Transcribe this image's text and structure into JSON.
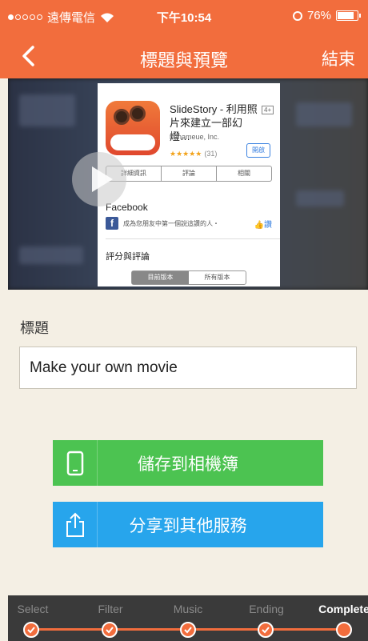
{
  "status_bar": {
    "carrier": "遠傳電信",
    "time": "下午10:54",
    "battery": "76%",
    "battery_level": 0.76
  },
  "nav": {
    "title": "標題與預覽",
    "done_label": "結束"
  },
  "preview": {
    "app_name": "SlideStory - 利用照片來建立一部幻燈…",
    "age_rating": "4+",
    "developer": "nanameue, Inc.",
    "rating_stars": "★★★★★",
    "rating_count": "(31)",
    "open_button": "開啟",
    "tabs": [
      "詳細資訊",
      "評論",
      "相關"
    ],
    "facebook_label": "Facebook",
    "facebook_text": "成為您朋友中第一個說這讚的人・",
    "like_label": "讚",
    "ratings_label": "評分與評論",
    "version_tabs": [
      "目前版本",
      "所有版本"
    ]
  },
  "form": {
    "title_label": "標題",
    "title_value": "Make your own movie"
  },
  "actions": {
    "save_label": "儲存到相機簿",
    "share_label": "分享到其他服務"
  },
  "stepper": {
    "steps": [
      "Select",
      "Filter",
      "Music",
      "Ending",
      "Complete"
    ],
    "active": "Complete"
  },
  "colors": {
    "accent": "#f26d3d",
    "save": "#4cc351",
    "share": "#27a5ec",
    "background": "#f4efe4",
    "stepper_bg": "#3a3a3a"
  }
}
